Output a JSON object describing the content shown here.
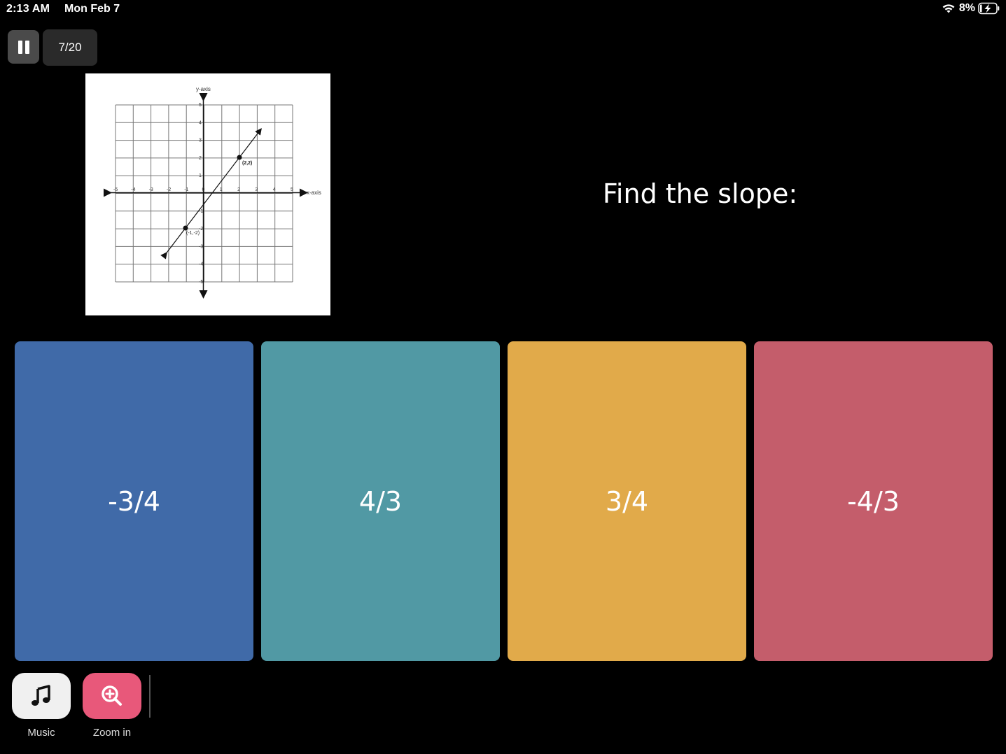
{
  "status": {
    "time": "2:13 AM",
    "date": "Mon Feb 7",
    "battery": "8%"
  },
  "header": {
    "counter": "7/20"
  },
  "question": {
    "text": "Find the slope:",
    "graph": {
      "x_axis_label": "x-axis",
      "y_axis_label": "y-axis",
      "x_ticks": [
        "-5",
        "-4",
        "-3",
        "-2",
        "-1",
        "0",
        "1",
        "2",
        "3",
        "4",
        "5"
      ],
      "y_ticks": [
        "5",
        "4",
        "3",
        "2",
        "1",
        "-1",
        "-2",
        "-3",
        "-4",
        "-5"
      ],
      "point1_label": "(2,2)",
      "point2_label": "(-1,-2)"
    }
  },
  "options": [
    {
      "label": "-3/4",
      "color": "#406aa8"
    },
    {
      "label": "4/3",
      "color": "#5199a4"
    },
    {
      "label": "3/4",
      "color": "#e1aa4a"
    },
    {
      "label": "-4/3",
      "color": "#c45d6b"
    }
  ],
  "tools": {
    "music_label": "Music",
    "zoom_label": "Zoom in",
    "music_bg": "#f0f0f0",
    "zoom_bg": "#e8587a"
  }
}
